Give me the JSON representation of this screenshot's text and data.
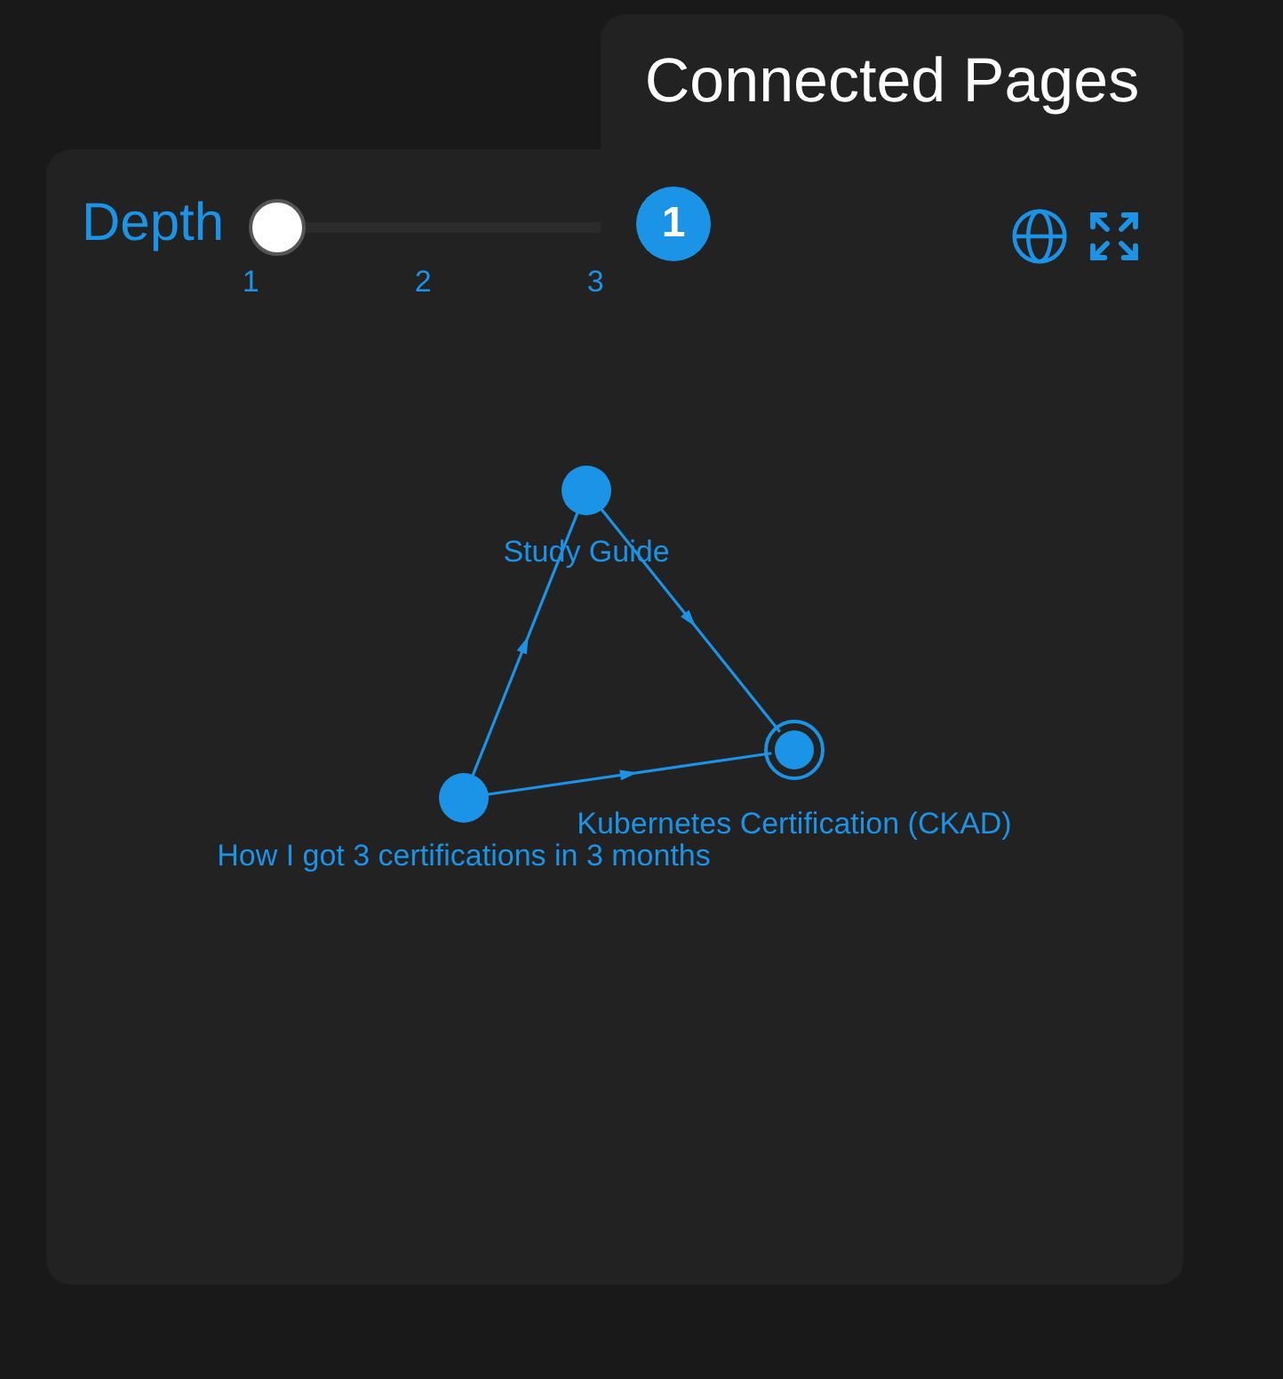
{
  "tab": {
    "title": "Connected Pages"
  },
  "depth": {
    "label": "Depth",
    "level": 0,
    "ticks": [
      "1",
      "2",
      "3"
    ],
    "value": "1"
  },
  "graph": {
    "nodes": [
      {
        "label": "Study Guide",
        "selected": false
      },
      {
        "label": "How I got 3 certifications in 3 months",
        "selected": false
      },
      {
        "label": "Kubernetes Certification (CKAD)",
        "selected": true
      }
    ]
  }
}
